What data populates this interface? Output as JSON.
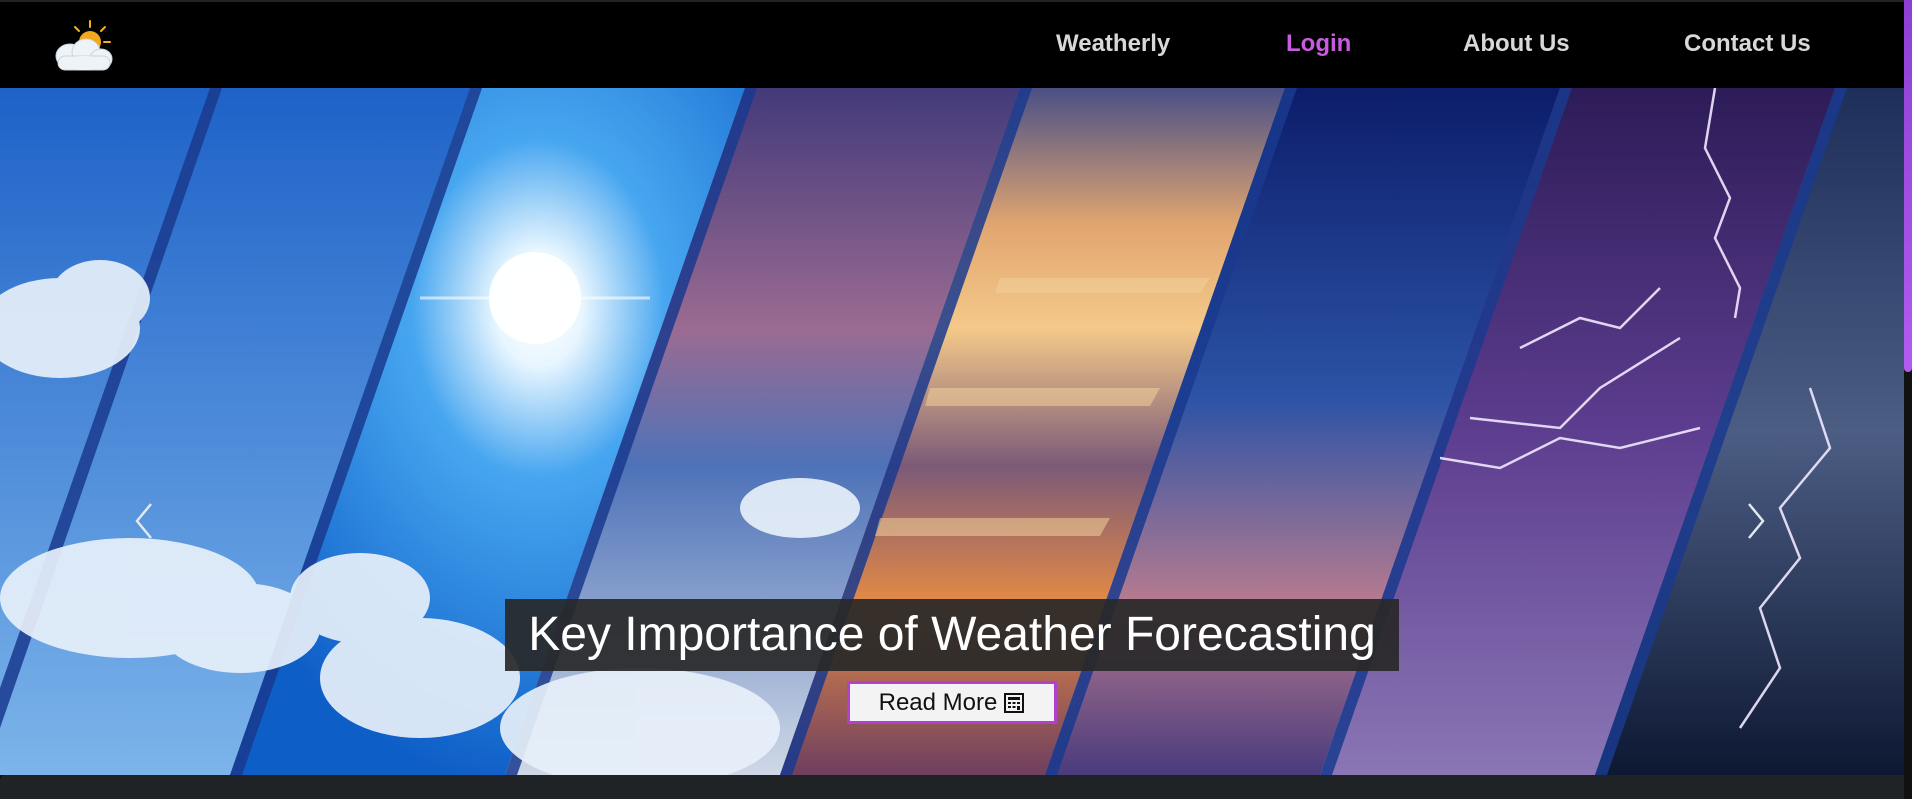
{
  "nav": {
    "brand": "Weatherly",
    "login": "Login",
    "about": "About Us",
    "contact": "Contact Us"
  },
  "hero": {
    "caption": "Key Importance of Weather Forecasting",
    "read_more_label": "Read More"
  },
  "colors": {
    "active_link": "#c85bdf",
    "button_border": "#b13fd0",
    "nav_bg": "#000000"
  },
  "icons": {
    "logo": "sun-cloud-logo-icon",
    "prev": "chevron-left-icon",
    "next": "chevron-right-icon",
    "button": "calculator-icon"
  }
}
